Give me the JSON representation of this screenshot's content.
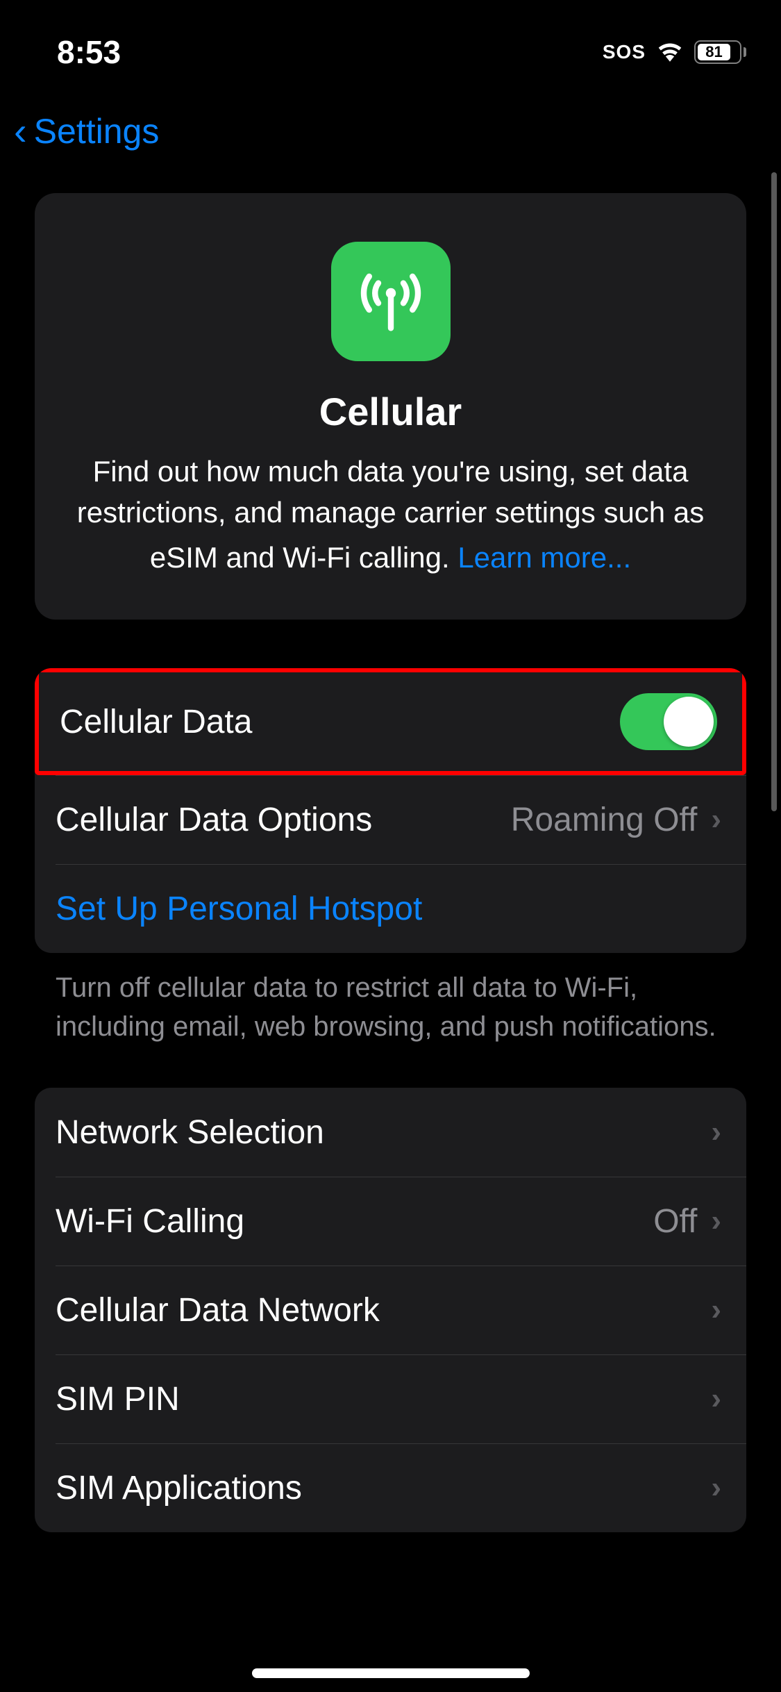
{
  "status": {
    "time": "8:53",
    "sos": "SOS",
    "battery": "81"
  },
  "nav": {
    "back_label": "Settings"
  },
  "hero": {
    "title": "Cellular",
    "description": "Find out how much data you're using, set data restrictions, and manage carrier settings such as eSIM and Wi-Fi calling.",
    "learn_more": "Learn more..."
  },
  "group1": {
    "cellular_data": {
      "label": "Cellular Data",
      "enabled": true
    },
    "cellular_data_options": {
      "label": "Cellular Data Options",
      "value": "Roaming Off"
    },
    "personal_hotspot": {
      "label": "Set Up Personal Hotspot"
    },
    "footer": "Turn off cellular data to restrict all data to Wi-Fi, including email, web browsing, and push notifications."
  },
  "group2": {
    "network_selection": {
      "label": "Network Selection"
    },
    "wifi_calling": {
      "label": "Wi-Fi Calling",
      "value": "Off"
    },
    "cellular_data_network": {
      "label": "Cellular Data Network"
    },
    "sim_pin": {
      "label": "SIM PIN"
    },
    "sim_applications": {
      "label": "SIM Applications"
    }
  }
}
